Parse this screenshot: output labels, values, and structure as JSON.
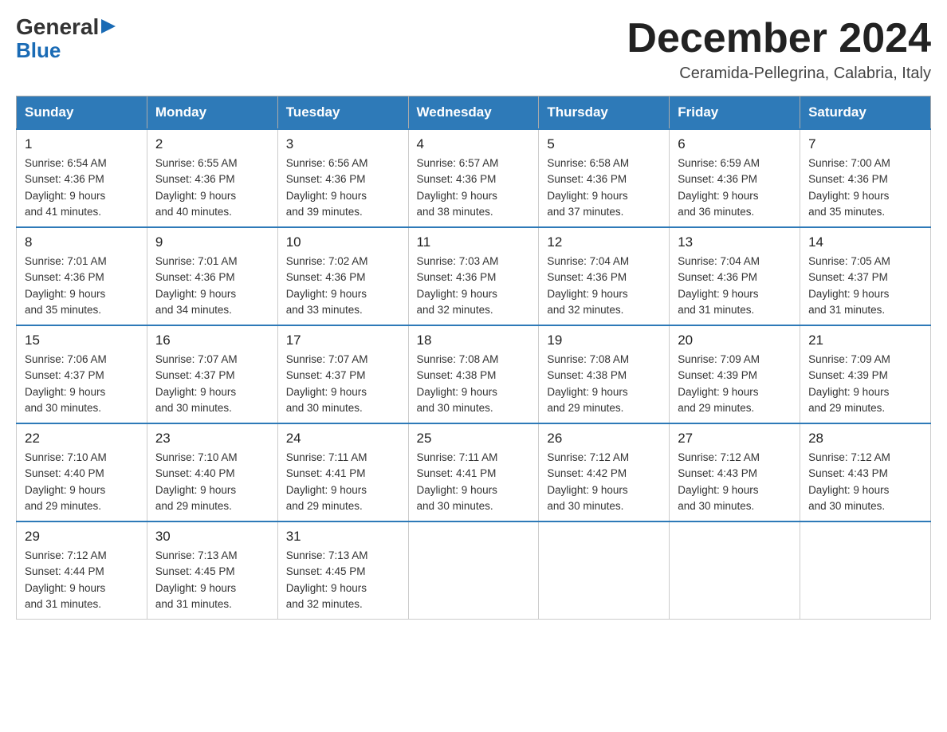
{
  "logo": {
    "general": "General",
    "blue": "Blue",
    "arrow": "▶"
  },
  "title": "December 2024",
  "subtitle": "Ceramida-Pellegrina, Calabria, Italy",
  "weekdays": [
    "Sunday",
    "Monday",
    "Tuesday",
    "Wednesday",
    "Thursday",
    "Friday",
    "Saturday"
  ],
  "weeks": [
    [
      {
        "day": "1",
        "sunrise": "6:54 AM",
        "sunset": "4:36 PM",
        "daylight": "9 hours and 41 minutes."
      },
      {
        "day": "2",
        "sunrise": "6:55 AM",
        "sunset": "4:36 PM",
        "daylight": "9 hours and 40 minutes."
      },
      {
        "day": "3",
        "sunrise": "6:56 AM",
        "sunset": "4:36 PM",
        "daylight": "9 hours and 39 minutes."
      },
      {
        "day": "4",
        "sunrise": "6:57 AM",
        "sunset": "4:36 PM",
        "daylight": "9 hours and 38 minutes."
      },
      {
        "day": "5",
        "sunrise": "6:58 AM",
        "sunset": "4:36 PM",
        "daylight": "9 hours and 37 minutes."
      },
      {
        "day": "6",
        "sunrise": "6:59 AM",
        "sunset": "4:36 PM",
        "daylight": "9 hours and 36 minutes."
      },
      {
        "day": "7",
        "sunrise": "7:00 AM",
        "sunset": "4:36 PM",
        "daylight": "9 hours and 35 minutes."
      }
    ],
    [
      {
        "day": "8",
        "sunrise": "7:01 AM",
        "sunset": "4:36 PM",
        "daylight": "9 hours and 35 minutes."
      },
      {
        "day": "9",
        "sunrise": "7:01 AM",
        "sunset": "4:36 PM",
        "daylight": "9 hours and 34 minutes."
      },
      {
        "day": "10",
        "sunrise": "7:02 AM",
        "sunset": "4:36 PM",
        "daylight": "9 hours and 33 minutes."
      },
      {
        "day": "11",
        "sunrise": "7:03 AM",
        "sunset": "4:36 PM",
        "daylight": "9 hours and 32 minutes."
      },
      {
        "day": "12",
        "sunrise": "7:04 AM",
        "sunset": "4:36 PM",
        "daylight": "9 hours and 32 minutes."
      },
      {
        "day": "13",
        "sunrise": "7:04 AM",
        "sunset": "4:36 PM",
        "daylight": "9 hours and 31 minutes."
      },
      {
        "day": "14",
        "sunrise": "7:05 AM",
        "sunset": "4:37 PM",
        "daylight": "9 hours and 31 minutes."
      }
    ],
    [
      {
        "day": "15",
        "sunrise": "7:06 AM",
        "sunset": "4:37 PM",
        "daylight": "9 hours and 30 minutes."
      },
      {
        "day": "16",
        "sunrise": "7:07 AM",
        "sunset": "4:37 PM",
        "daylight": "9 hours and 30 minutes."
      },
      {
        "day": "17",
        "sunrise": "7:07 AM",
        "sunset": "4:37 PM",
        "daylight": "9 hours and 30 minutes."
      },
      {
        "day": "18",
        "sunrise": "7:08 AM",
        "sunset": "4:38 PM",
        "daylight": "9 hours and 30 minutes."
      },
      {
        "day": "19",
        "sunrise": "7:08 AM",
        "sunset": "4:38 PM",
        "daylight": "9 hours and 29 minutes."
      },
      {
        "day": "20",
        "sunrise": "7:09 AM",
        "sunset": "4:39 PM",
        "daylight": "9 hours and 29 minutes."
      },
      {
        "day": "21",
        "sunrise": "7:09 AM",
        "sunset": "4:39 PM",
        "daylight": "9 hours and 29 minutes."
      }
    ],
    [
      {
        "day": "22",
        "sunrise": "7:10 AM",
        "sunset": "4:40 PM",
        "daylight": "9 hours and 29 minutes."
      },
      {
        "day": "23",
        "sunrise": "7:10 AM",
        "sunset": "4:40 PM",
        "daylight": "9 hours and 29 minutes."
      },
      {
        "day": "24",
        "sunrise": "7:11 AM",
        "sunset": "4:41 PM",
        "daylight": "9 hours and 29 minutes."
      },
      {
        "day": "25",
        "sunrise": "7:11 AM",
        "sunset": "4:41 PM",
        "daylight": "9 hours and 30 minutes."
      },
      {
        "day": "26",
        "sunrise": "7:12 AM",
        "sunset": "4:42 PM",
        "daylight": "9 hours and 30 minutes."
      },
      {
        "day": "27",
        "sunrise": "7:12 AM",
        "sunset": "4:43 PM",
        "daylight": "9 hours and 30 minutes."
      },
      {
        "day": "28",
        "sunrise": "7:12 AM",
        "sunset": "4:43 PM",
        "daylight": "9 hours and 30 minutes."
      }
    ],
    [
      {
        "day": "29",
        "sunrise": "7:12 AM",
        "sunset": "4:44 PM",
        "daylight": "9 hours and 31 minutes."
      },
      {
        "day": "30",
        "sunrise": "7:13 AM",
        "sunset": "4:45 PM",
        "daylight": "9 hours and 31 minutes."
      },
      {
        "day": "31",
        "sunrise": "7:13 AM",
        "sunset": "4:45 PM",
        "daylight": "9 hours and 32 minutes."
      },
      null,
      null,
      null,
      null
    ]
  ],
  "sunrise_label": "Sunrise: ",
  "sunset_label": "Sunset: ",
  "daylight_label": "Daylight: "
}
